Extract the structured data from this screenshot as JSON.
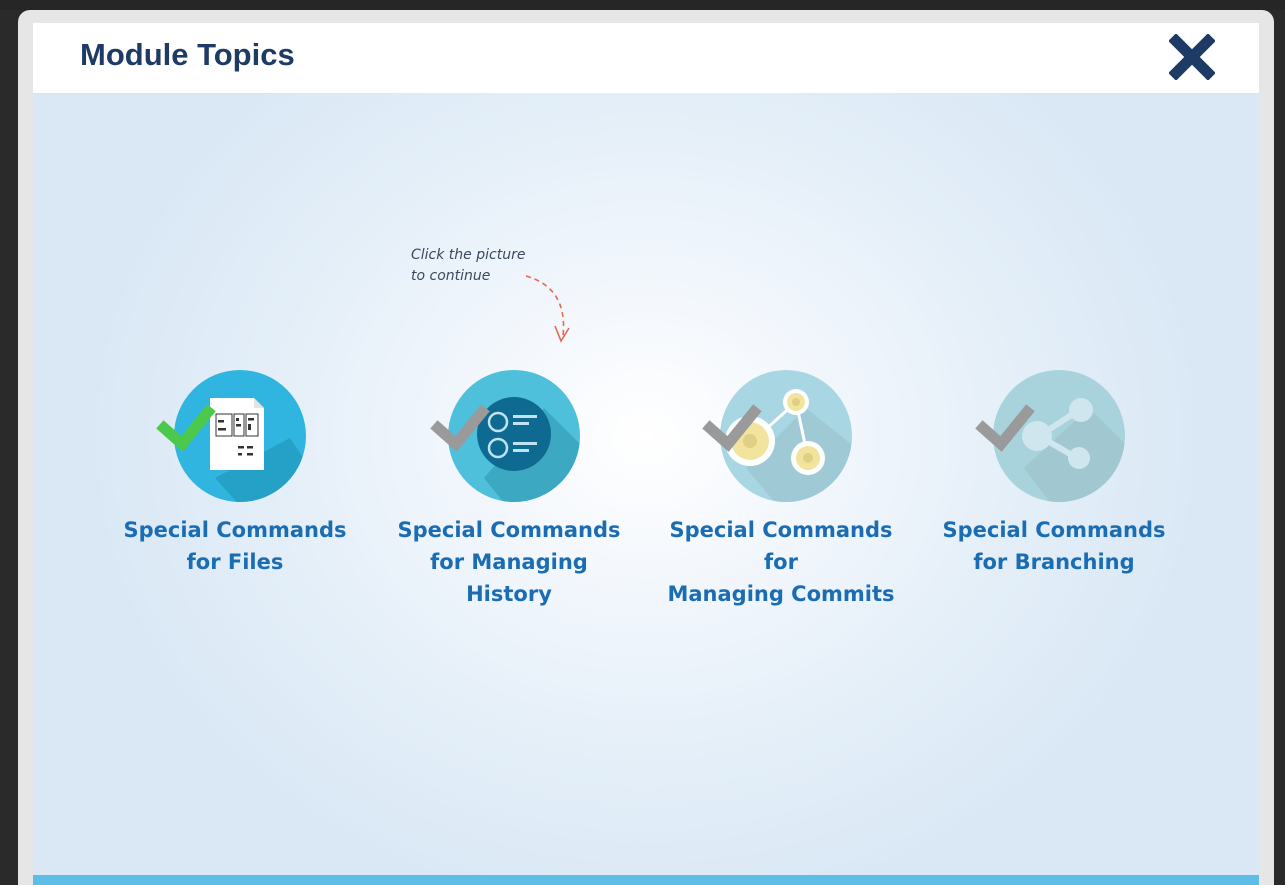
{
  "header": {
    "title": "Module Topics",
    "close_icon": "close-x-icon"
  },
  "hint": {
    "line1": "Click the picture",
    "line2": "to continue"
  },
  "topics": [
    {
      "line1": "Special Commands",
      "line2": "for Files",
      "completed": true,
      "icon": "document-icon"
    },
    {
      "line1": "Special Commands",
      "line2": "for Managing History",
      "completed": false,
      "icon": "history-list-icon"
    },
    {
      "line1": "Special Commands for",
      "line2": "Managing Commits",
      "completed": false,
      "icon": "commits-graph-icon"
    },
    {
      "line1": "Special Commands",
      "line2": "for Branching",
      "completed": false,
      "icon": "share-branch-icon"
    }
  ],
  "colors": {
    "title": "#1e3b66",
    "label": "#1a6db3",
    "check_done": "#4cc94c",
    "check_pending": "#9a9a9a",
    "bottom_bar": "#5ebde6"
  }
}
